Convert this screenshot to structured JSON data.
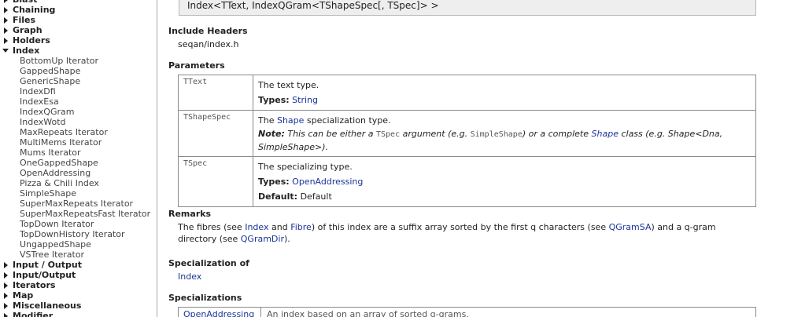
{
  "sidebar": {
    "groups_top": [
      {
        "label": "Blast",
        "expanded": false
      },
      {
        "label": "Chaining",
        "expanded": false
      },
      {
        "label": "Files",
        "expanded": false
      },
      {
        "label": "Graph",
        "expanded": false
      },
      {
        "label": "Holders",
        "expanded": false
      },
      {
        "label": "Index",
        "expanded": true
      }
    ],
    "index_items": [
      "BottomUp Iterator",
      "GappedShape",
      "GenericShape",
      "IndexDfi",
      "IndexEsa",
      "IndexQGram",
      "IndexWotd",
      "MaxRepeats Iterator",
      "MultiMems Iterator",
      "Mums Iterator",
      "OneGappedShape",
      "OpenAddressing",
      "Pizza & Chili Index",
      "SimpleShape",
      "SuperMaxRepeats Iterator",
      "SuperMaxRepeatsFast Iterator",
      "TopDown Iterator",
      "TopDownHistory Iterator",
      "UngappedShape",
      "VSTree Iterator"
    ],
    "groups_bottom": [
      {
        "label": "Input / Output",
        "expanded": false
      },
      {
        "label": "Input/Output",
        "expanded": false
      },
      {
        "label": "Iterators",
        "expanded": false
      },
      {
        "label": "Map",
        "expanded": false
      },
      {
        "label": "Miscellaneous",
        "expanded": false
      },
      {
        "label": "Modifier",
        "expanded": false
      }
    ]
  },
  "main": {
    "signature": "Index<TText, IndexQGram<TShapeSpec[, TSpec]> >",
    "include_headers": {
      "title": "Include Headers",
      "value": "seqan/index.h"
    },
    "parameters": {
      "title": "Parameters",
      "rows": [
        {
          "name": "TText",
          "desc": "The text type.",
          "types_label": "Types:",
          "types_value": "String"
        },
        {
          "name": "TShapeSpec",
          "desc_pre": "The ",
          "desc_link": "Shape",
          "desc_post": " specialization type.",
          "note_label": "Note:",
          "note_1": " This can be either a ",
          "note_code": "TSpec",
          "note_2": " argument (e.g. ",
          "note_code2": "SimpleShape",
          "note_3": ") or a complete ",
          "note_link": "Shape",
          "note_4": " class (e.g. Shape<Dna,",
          "note_5": "SimpleShape>)."
        },
        {
          "name": "TSpec",
          "desc": "The specializing type.",
          "types_label": "Types:",
          "types_value": "OpenAddressing",
          "default_label": "Default:",
          "default_value": "Default"
        }
      ]
    },
    "remarks": {
      "title": "Remarks",
      "t1": "The fibres (see ",
      "l1": "Index",
      "t2": " and ",
      "l2": "Fibre",
      "t3": ") of this index are a suffix array sorted by the first q characters (see ",
      "l3": "QGramSA",
      "t4": ") and a q-gram",
      "t5": "directory (see ",
      "l4": "QGramDir",
      "t6": ")."
    },
    "specialization_of": {
      "title": "Specialization of",
      "value": "Index"
    },
    "specializations": {
      "title": "Specializations",
      "rows": [
        {
          "name": "OpenAddressing",
          "desc": "An index based on an array of sorted q-grams."
        }
      ]
    }
  }
}
